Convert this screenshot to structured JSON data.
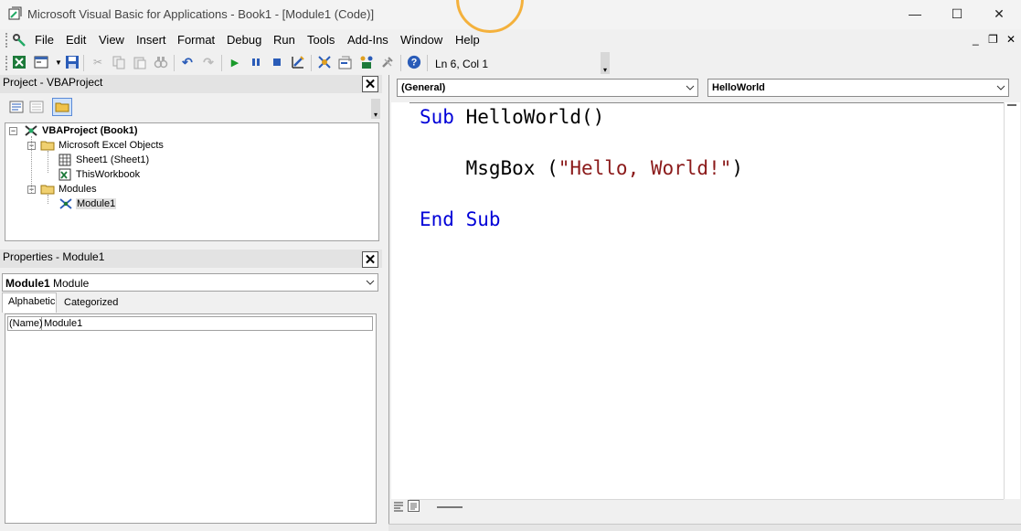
{
  "window": {
    "title": "Microsoft Visual Basic for Applications - Book1 - [Module1 (Code)]",
    "controls": {
      "minimize": "—",
      "maximize": "☐",
      "close": "✕"
    }
  },
  "menu": {
    "items": [
      "File",
      "Edit",
      "View",
      "Insert",
      "Format",
      "Debug",
      "Run",
      "Tools",
      "Add-Ins",
      "Window",
      "Help"
    ],
    "mdi_controls": {
      "minimize": "_",
      "restore": "❐",
      "close": "✕"
    }
  },
  "toolbar": {
    "status": "Ln 6, Col 1"
  },
  "project": {
    "title": "Project - VBAProject",
    "close": "✕",
    "tree": {
      "root": "VBAProject (Book1)",
      "excel_objects": "Microsoft Excel Objects",
      "sheet1": "Sheet1 (Sheet1)",
      "workbook": "ThisWorkbook",
      "modules": "Modules",
      "module1": "Module1"
    },
    "icons": {
      "expand": "⊟",
      "collapse": "⊟"
    }
  },
  "properties": {
    "title": "Properties - Module1",
    "close": "✕",
    "object_name": "Module1",
    "object_type": "Module",
    "tabs": {
      "alphabetic": "Alphabetic",
      "categorized": "Categorized"
    },
    "rows": [
      {
        "name": "(Name)",
        "value": "Module1"
      }
    ]
  },
  "code": {
    "object_combo": "(General)",
    "procedure_combo": "HelloWorld",
    "lines": {
      "sub_kw": "Sub",
      "sub_name": " HelloWorld()",
      "msg_indent": "    MsgBox (",
      "msg_string": "\"Hello, World!\"",
      "msg_close": ")",
      "end_kw": "End Sub"
    }
  },
  "colors": {
    "keyword": "#0000d8",
    "string": "#8b1a1a",
    "cursor_ring": "#f4b13c"
  }
}
